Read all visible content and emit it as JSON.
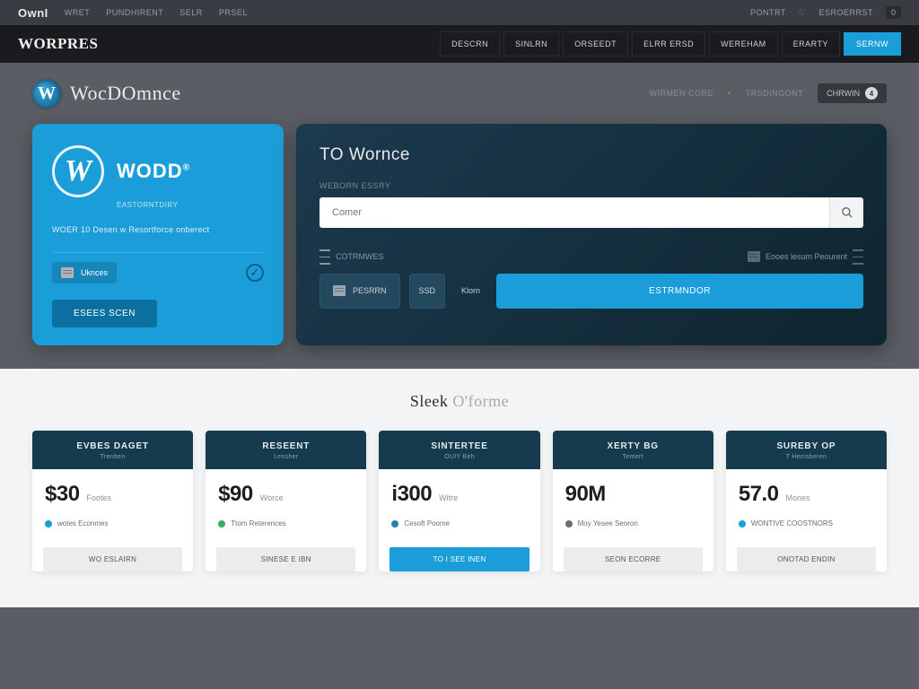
{
  "topbar": {
    "brand": "OwnI",
    "links": [
      "WRET",
      "PUNDHIRENT",
      "SELR",
      "PRSEL"
    ],
    "right": [
      "PONTRT"
    ],
    "badge": "0"
  },
  "navbar": {
    "brand": "WORPRES",
    "links": [
      "DESCRN",
      "SINLRN",
      "ORSEEDT",
      "ELRR ERSD",
      "WEREHAM",
      "ERARTY"
    ],
    "cta": "SERNW"
  },
  "subheader": {
    "title": "WocDOmnce",
    "links": [
      "WIRMEN CORE",
      "TRSDINGONT"
    ],
    "chip": "CHRWIN",
    "chip_badge": "4"
  },
  "hero_left": {
    "title": "WODD",
    "subtitle": "EASTORNTDIRY",
    "tagline": "WOER 10 Desen w Resortforce onberect",
    "pill": "Uknces",
    "cta": "ESEES SCEN"
  },
  "hero_right": {
    "title": "TO Wornce",
    "label": "WEBORN ESSRY",
    "placeholder": "Comer",
    "meta_left": "COTRMWES",
    "meta_right": "Eooes lesum Peourent",
    "chip1": "PESRRN",
    "chip2": "SSD",
    "chip_ghost": "Klorn",
    "primary": "ESTRMNDOR"
  },
  "section": {
    "title_a": "Sleek",
    "title_b": "O'forme"
  },
  "plans": [
    {
      "name": "EVBES DAGET",
      "sub": "Trenben",
      "price": "$30",
      "unit": "Footes",
      "feat": "wotes Econmes",
      "cta": "WO ESLAIRN"
    },
    {
      "name": "RESEENT",
      "sub": "Lensher",
      "price": "$90",
      "unit": "Worce",
      "feat": "Ttom Reterences",
      "cta": "SINESE E IBN"
    },
    {
      "name": "SINTERTEE",
      "sub": "OUIY Beh",
      "price": "i300",
      "unit": "Witre",
      "feat": "Cesoft Poome",
      "cta": "TO I SEE INEN"
    },
    {
      "name": "XERTY BG",
      "sub": "Temert",
      "price": "90M",
      "unit": "",
      "feat": "Moy Yesee Seoron",
      "cta": "SEON ECORRE"
    },
    {
      "name": "SUREBY OP",
      "sub": "T Hemsberen",
      "price": "57.0",
      "unit": "Mones",
      "feat": "WONTIVE COOSTNORS",
      "cta": "ONOTAD ENDIN"
    }
  ],
  "feat_colors": [
    "#1a9dd9",
    "#3aaa6a",
    "#2b7fb0",
    "#6a6e74",
    "#1a9dd9"
  ]
}
